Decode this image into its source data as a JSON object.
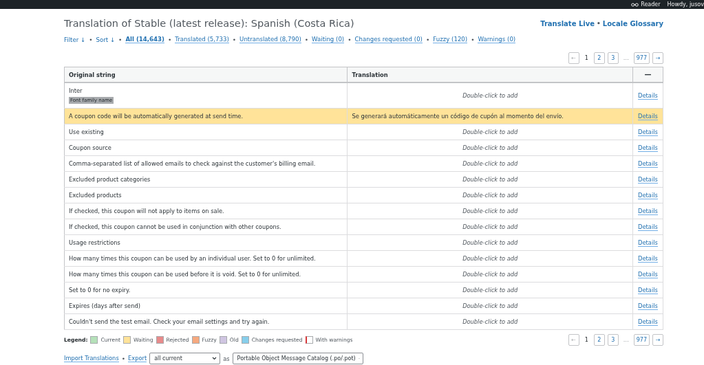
{
  "admin_bar": {
    "reader": "Reader",
    "greeting": "Howdy, jusov"
  },
  "title": "Translation of Stable (latest release): Spanish (Costa Rica)",
  "header_links": [
    "Translate Live",
    "Locale Glossary"
  ],
  "separator": "•",
  "filters": [
    {
      "label": "Filter ↓",
      "kind": "menu",
      "selected": false
    },
    {
      "label": "Sort ↓",
      "kind": "menu",
      "selected": false
    },
    {
      "label": "All (14,643)",
      "kind": "count",
      "selected": true
    },
    {
      "label": "Translated (5,733)",
      "kind": "count",
      "selected": false
    },
    {
      "label": "Untranslated (8,790)",
      "kind": "count",
      "selected": false
    },
    {
      "label": "Waiting (0)",
      "kind": "count",
      "selected": false
    },
    {
      "label": "Changes requested (0)",
      "kind": "count",
      "selected": false
    },
    {
      "label": "Fuzzy (120)",
      "kind": "count",
      "selected": false
    },
    {
      "label": "Warnings (0)",
      "kind": "count",
      "selected": false
    }
  ],
  "pagination_top": {
    "prev": "←",
    "next": "→",
    "items": [
      {
        "kind": "page",
        "label": "1",
        "selected": true
      },
      {
        "kind": "page",
        "label": "2",
        "selected": false
      },
      {
        "kind": "page",
        "label": "3",
        "selected": false
      },
      {
        "kind": "ellipsis",
        "label": "…"
      },
      {
        "kind": "page",
        "label": "977",
        "selected": false
      }
    ]
  },
  "table": {
    "columns": [
      "Original string",
      "Translation",
      "—"
    ],
    "rows": [
      {
        "original": "Inter",
        "context": "Font family name",
        "translation": "Double-click to add",
        "waiting": false,
        "action": "Details"
      },
      {
        "original": "A coupon code will be automatically generated at send time.",
        "translation": "Se generará automáticamente un código de cupón al momento del envío.",
        "waiting": true,
        "action": "Details"
      },
      {
        "original": "Use existing",
        "translation": "Double-click to add",
        "waiting": false,
        "action": "Details"
      },
      {
        "original": "Coupon source",
        "translation": "Double-click to add",
        "waiting": false,
        "action": "Details"
      },
      {
        "original": "Comma-separated list of allowed emails to check against the customer's billing email.",
        "translation": "Double-click to add",
        "waiting": false,
        "action": "Details"
      },
      {
        "original": "Excluded product categories",
        "translation": "Double-click to add",
        "waiting": false,
        "action": "Details"
      },
      {
        "original": "Excluded products",
        "translation": "Double-click to add",
        "waiting": false,
        "action": "Details"
      },
      {
        "original": "If checked, this coupon will not apply to items on sale.",
        "translation": "Double-click to add",
        "waiting": false,
        "action": "Details"
      },
      {
        "original": "If checked, this coupon cannot be used in conjunction with other coupons.",
        "translation": "Double-click to add",
        "waiting": false,
        "action": "Details"
      },
      {
        "original": "Usage restrictions",
        "translation": "Double-click to add",
        "waiting": false,
        "action": "Details"
      },
      {
        "original": "How many times this coupon can be used by an individual user. Set to 0 for unlimited.",
        "translation": "Double-click to add",
        "waiting": false,
        "action": "Details"
      },
      {
        "original": "How many times this coupon can be used before it is void. Set to 0 for unlimited.",
        "translation": "Double-click to add",
        "waiting": false,
        "action": "Details"
      },
      {
        "original": "Set to 0 for no expiry.",
        "translation": "Double-click to add",
        "waiting": false,
        "action": "Details"
      },
      {
        "original": "Expires (days after send)",
        "translation": "Double-click to add",
        "waiting": false,
        "action": "Details"
      },
      {
        "original": "Couldn't send the test email. Check your email settings and try again.",
        "translation": "Double-click to add",
        "waiting": false,
        "action": "Details"
      }
    ]
  },
  "legend": {
    "label": "Legend:",
    "items": [
      {
        "label": "Current",
        "color": "#b5e1b9"
      },
      {
        "label": "Waiting",
        "color": "#ffe399"
      },
      {
        "label": "Rejected",
        "color": "#e88b8b"
      },
      {
        "label": "Fuzzy",
        "color": "#f6a97f"
      },
      {
        "label": "Old",
        "color": "#cfc5e1"
      },
      {
        "label": "Changes requested",
        "color": "#87ceeb"
      },
      {
        "label": "With warnings",
        "color": "#ffffff"
      }
    ]
  },
  "pagination_bottom": {
    "prev": "←",
    "next": "→",
    "items": [
      {
        "kind": "page",
        "label": "1",
        "selected": true
      },
      {
        "kind": "page",
        "label": "2",
        "selected": false
      },
      {
        "kind": "page",
        "label": "3",
        "selected": false
      },
      {
        "kind": "ellipsis",
        "label": "…"
      },
      {
        "kind": "page",
        "label": "977",
        "selected": false
      }
    ]
  },
  "footer": {
    "import_link": "Import Translations",
    "export_link": "Export",
    "export_filter": "all current",
    "as_label": "as",
    "format": "Portable Object Message Catalog (.po/.pot)"
  }
}
